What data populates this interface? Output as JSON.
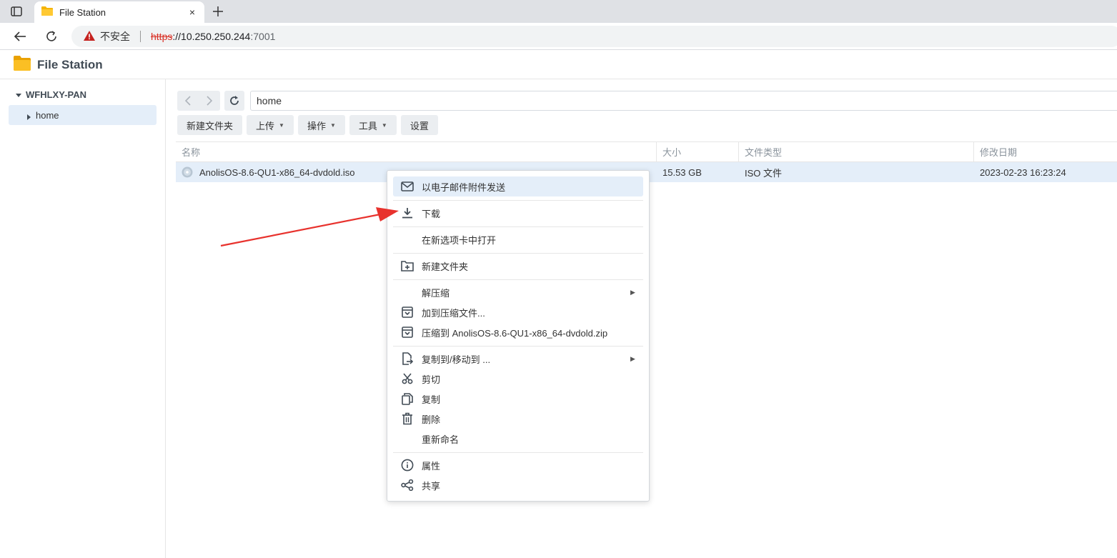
{
  "browser": {
    "tab_title": "File Station",
    "tab_close": "×",
    "security_warning": "不安全",
    "url_scheme": "https",
    "url_host": "://10.250.250.244",
    "url_port": ":7001"
  },
  "app": {
    "title": "File Station"
  },
  "sidebar": {
    "root_label": "WFHLXY-PAN",
    "items": [
      {
        "label": "home"
      }
    ]
  },
  "toolbar": {
    "path": "home",
    "buttons": {
      "new_folder": "新建文件夹",
      "upload": "上传",
      "action": "操作",
      "tools": "工具",
      "settings": "设置"
    }
  },
  "table": {
    "columns": {
      "name": "名称",
      "size": "大小",
      "type": "文件类型",
      "modified": "修改日期"
    },
    "rows": [
      {
        "name": "AnolisOS-8.6-QU1-x86_64-dvdold.iso",
        "size": "15.53 GB",
        "type": "ISO 文件",
        "modified": "2023-02-23 16:23:24"
      }
    ]
  },
  "context_menu": {
    "email": "以电子邮件附件发送",
    "download": "下载",
    "open_new_tab": "在新选项卡中打开",
    "new_folder": "新建文件夹",
    "extract": "解压缩",
    "add_archive": "加到压缩文件...",
    "compress_to": "压缩到 AnolisOS-8.6-QU1-x86_64-dvdold.zip",
    "copy_move": "复制到/移动到 ...",
    "cut": "剪切",
    "copy": "复制",
    "delete": "删除",
    "rename": "重新命名",
    "properties": "属性",
    "share": "共享"
  },
  "colors": {
    "highlight": "#e4eef9",
    "annotation_arrow": "#e8322d",
    "folder_icon": "#f5b400"
  }
}
